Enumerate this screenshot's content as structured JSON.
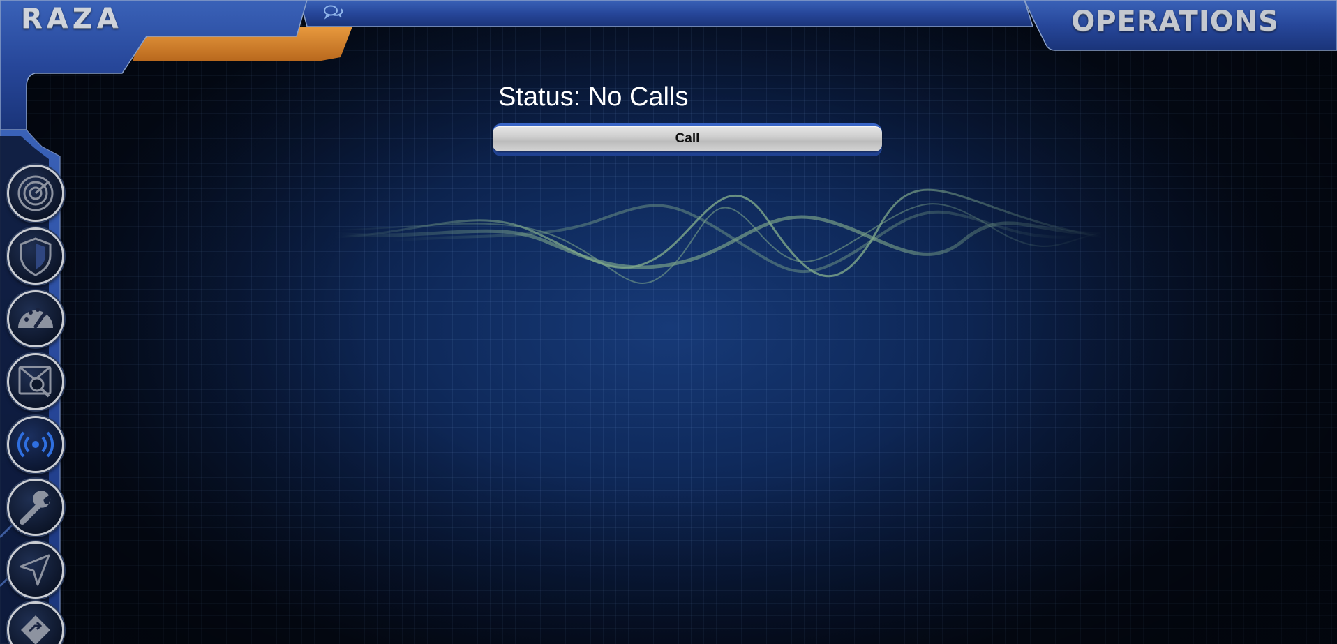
{
  "header": {
    "brand": "RAZA",
    "section": "OPERATIONS",
    "chat_icon": "chat-bubbles-icon"
  },
  "status": {
    "label": "Status: No Calls"
  },
  "call": {
    "button_label": "Call"
  },
  "sidebar": {
    "items": [
      {
        "name": "radar",
        "icon": "radar-icon",
        "active": false
      },
      {
        "name": "shield",
        "icon": "shield-icon",
        "active": false
      },
      {
        "name": "dashboard",
        "icon": "speedometer-icon",
        "active": false
      },
      {
        "name": "scan",
        "icon": "search-screen-icon",
        "active": false
      },
      {
        "name": "broadcast",
        "icon": "broadcast-icon",
        "active": true
      },
      {
        "name": "repair",
        "icon": "wrench-icon",
        "active": false
      },
      {
        "name": "navigation",
        "icon": "navigation-arrow-icon",
        "active": false
      },
      {
        "name": "route",
        "icon": "route-diamond-icon",
        "active": false
      }
    ]
  },
  "colors": {
    "frame_blue": "#2c4f9e",
    "accent_orange": "#d9852e",
    "icon_gray": "#c9ccd2",
    "icon_active_blue": "#2f6fe0",
    "wave_green": "#7fa88a"
  }
}
